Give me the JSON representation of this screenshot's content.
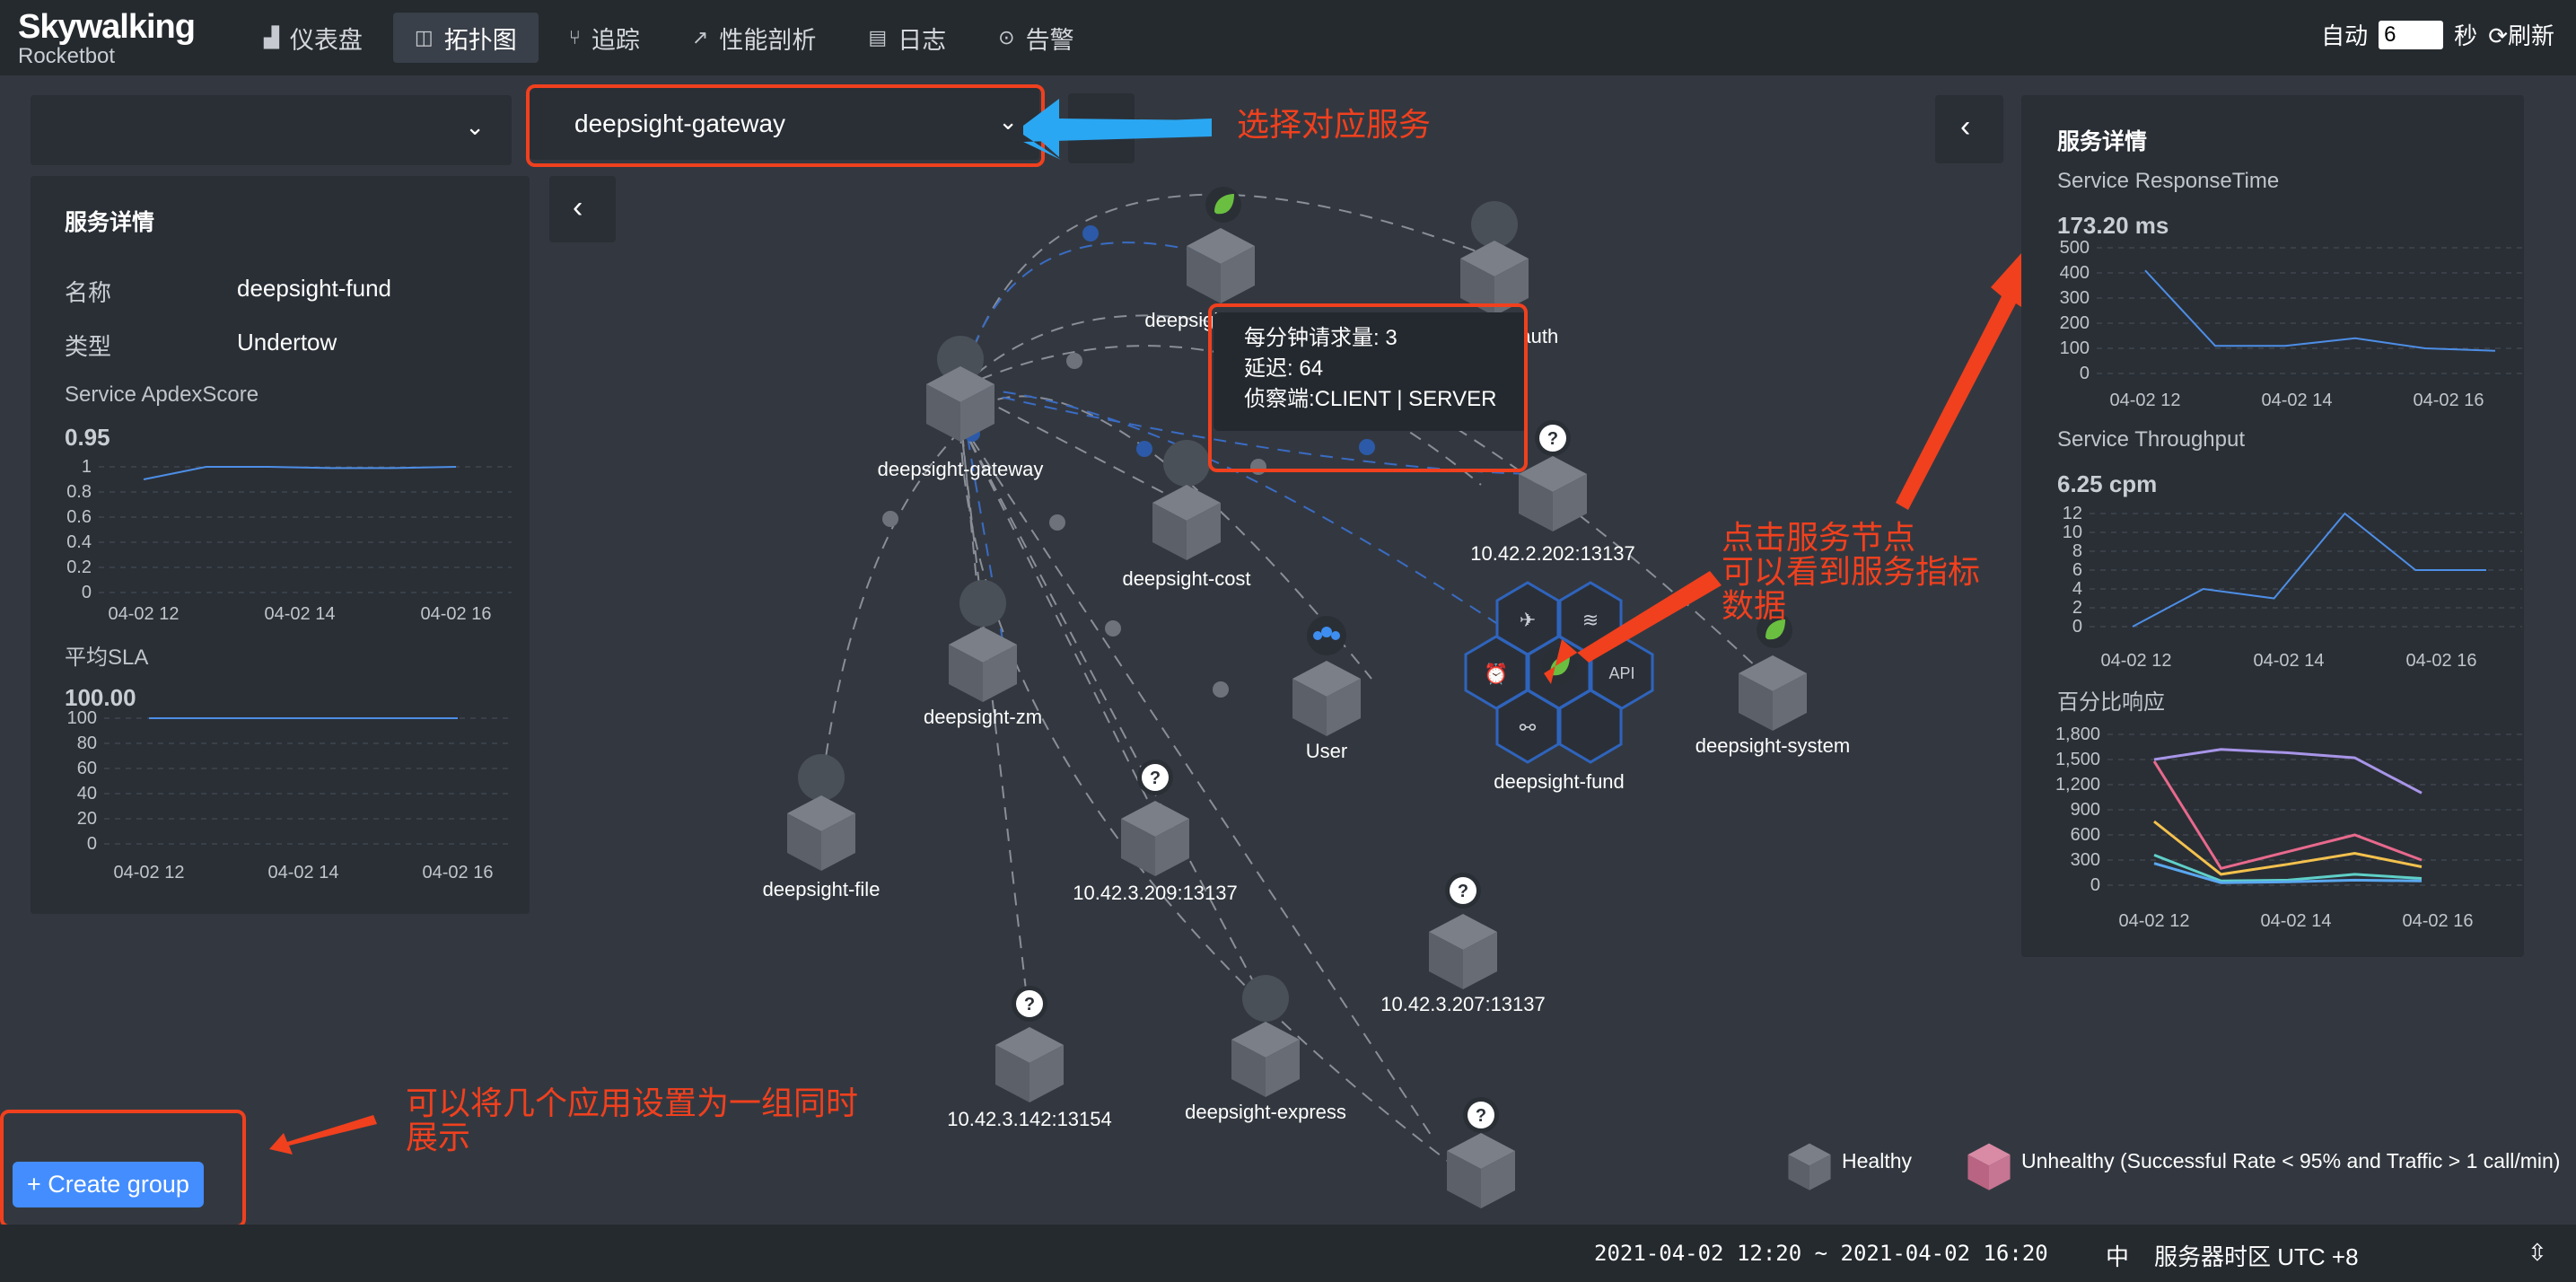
{
  "app": {
    "logo_name": "Skywalking",
    "logo_sub": "Rocketbot"
  },
  "nav": [
    {
      "label": "仪表盘",
      "icon": "chart-icon"
    },
    {
      "label": "拓扑图",
      "icon": "topology-icon"
    },
    {
      "label": "追踪",
      "icon": "trace-icon"
    },
    {
      "label": "性能剖析",
      "icon": "profile-icon"
    },
    {
      "label": "日志",
      "icon": "log-icon"
    },
    {
      "label": "告警",
      "icon": "alarm-icon"
    }
  ],
  "auto": {
    "label": "自动",
    "value": "6",
    "unit": "秒",
    "refresh": "刷新"
  },
  "selects": {
    "group_value": "",
    "service_value": "deepsight-gateway"
  },
  "left_panel": {
    "title": "服务详情",
    "name_label": "名称",
    "name_value": "deepsight-fund",
    "type_label": "类型",
    "type_value": "Undertow",
    "apdex_label": "Service ApdexScore",
    "apdex_value": "0.95",
    "apdex_yticks": [
      "1",
      "0.8",
      "0.6",
      "0.4",
      "0.2",
      "0"
    ],
    "sla_label": "平均SLA",
    "sla_value": "100.00",
    "sla_yticks": [
      "100",
      "80",
      "60",
      "40",
      "20",
      "0"
    ],
    "xticks": [
      "04-02 12",
      "04-02 14",
      "04-02 16"
    ]
  },
  "right_panel": {
    "title": "服务详情",
    "rt_label": "Service ResponseTime",
    "rt_value": "173.20 ms",
    "rt_yticks": [
      "500",
      "400",
      "300",
      "200",
      "100",
      "0"
    ],
    "tp_label": "Service Throughput",
    "tp_value": "6.25 cpm",
    "tp_yticks": [
      "12",
      "10",
      "8",
      "6",
      "4",
      "2",
      "0"
    ],
    "pct_label": "百分比响应",
    "pct_yticks": [
      "1,800",
      "1,500",
      "1,200",
      "900",
      "600",
      "300",
      "0"
    ],
    "xticks": [
      "04-02 12",
      "04-02 14",
      "04-02 16"
    ]
  },
  "chart_data": [
    {
      "type": "line",
      "title": "Service ApdexScore",
      "x": [
        0,
        1,
        2,
        3,
        4,
        5
      ],
      "series": [
        {
          "values": [
            0.9,
            1,
            1,
            0.99,
            0.99,
            1
          ]
        }
      ],
      "ylim": [
        0,
        1
      ]
    },
    {
      "type": "line",
      "title": "平均SLA",
      "x": [
        0,
        1,
        2,
        3,
        4,
        5
      ],
      "series": [
        {
          "values": [
            100,
            100,
            100,
            100,
            100,
            100
          ]
        }
      ],
      "ylim": [
        0,
        100
      ]
    },
    {
      "type": "line",
      "title": "Service ResponseTime",
      "x": [
        0,
        1,
        2,
        3,
        4,
        5
      ],
      "series": [
        {
          "values": [
            410,
            110,
            110,
            140,
            100,
            90
          ]
        }
      ],
      "ylim": [
        0,
        500
      ]
    },
    {
      "type": "line",
      "title": "Service Throughput",
      "x": [
        0,
        1,
        2,
        3,
        4,
        5
      ],
      "series": [
        {
          "values": [
            0,
            4,
            3,
            12,
            6,
            6
          ]
        }
      ],
      "ylim": [
        0,
        12
      ]
    },
    {
      "type": "line",
      "title": "百分比响应",
      "x": [
        0,
        1,
        2,
        3,
        4,
        5
      ],
      "series": [
        {
          "values": [
            1500,
            1620,
            1580,
            1520,
            1100,
            1100
          ],
          "color": "#a895e8"
        },
        {
          "values": [
            1480,
            200,
            400,
            600,
            300,
            300
          ],
          "color": "#e8698c"
        },
        {
          "values": [
            760,
            130,
            250,
            380,
            220,
            220
          ],
          "color": "#f3c14d"
        },
        {
          "values": [
            360,
            50,
            60,
            130,
            80,
            80
          ],
          "color": "#5fd0c8"
        },
        {
          "values": [
            260,
            30,
            40,
            60,
            50,
            50
          ],
          "color": "#5aa8f0"
        }
      ],
      "ylim": [
        0,
        1800
      ]
    }
  ],
  "tooltip": {
    "l1_label": "每分钟请求量:",
    "l1_value": "3",
    "l2_label": "延迟:",
    "l2_value": "64",
    "l3_label": "侦察端:",
    "l3_value": "CLIENT | SERVER"
  },
  "nodes": [
    {
      "name": "deepsight-gateway"
    },
    {
      "name": "deepsigh"
    },
    {
      "name": "-oauth"
    },
    {
      "name": "10.42.2.202:13137"
    },
    {
      "name": "deepsight-cost"
    },
    {
      "name": "deepsight-zm"
    },
    {
      "name": "User"
    },
    {
      "name": "deepsight-fund"
    },
    {
      "name": "deepsight-system"
    },
    {
      "name": "deepsight-file"
    },
    {
      "name": "10.42.3.209:13137"
    },
    {
      "name": "10.42.3.207:13137"
    },
    {
      "name": "10.42.3.142:13154"
    },
    {
      "name": "deepsight-express"
    }
  ],
  "annotations": {
    "a1": "选择对应服务",
    "a2": [
      "点击服务节点",
      "可以看到服务指标",
      "数据"
    ],
    "a3": [
      "可以将几个应用设置为一组同时",
      "展示"
    ]
  },
  "create_group": "+ Create group",
  "legend": {
    "healthy": "Healthy",
    "unhealthy": "Unhealthy (Successful Rate < 95% and Traffic > 1 call/min)"
  },
  "footer": {
    "range": "2021-04-02 12:20 ~ 2021-04-02 16:20",
    "lang": "中",
    "tz": "服务器时区 UTC +8"
  }
}
